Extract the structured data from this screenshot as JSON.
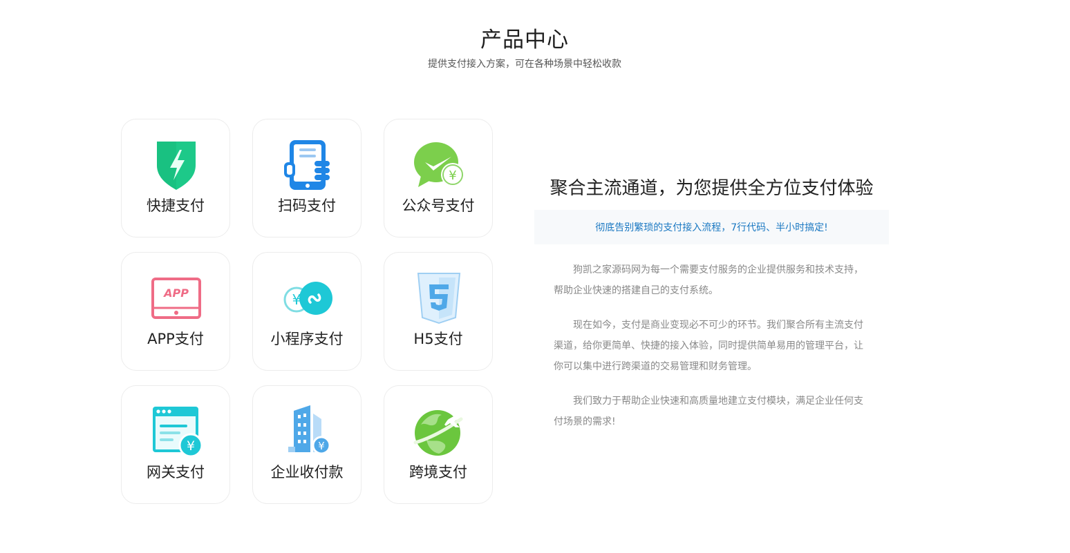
{
  "header": {
    "title": "产品中心",
    "subtitle": "提供支付接入方案，可在各种场景中轻松收款"
  },
  "products": [
    {
      "label": "快捷支付",
      "icon": "shield-lightning-icon"
    },
    {
      "label": "扫码支付",
      "icon": "phone-scan-icon"
    },
    {
      "label": "公众号支付",
      "icon": "wechat-pay-icon"
    },
    {
      "label": "APP支付",
      "icon": "app-screen-icon"
    },
    {
      "label": "小程序支付",
      "icon": "mini-program-icon"
    },
    {
      "label": "H5支付",
      "icon": "html5-icon"
    },
    {
      "label": "网关支付",
      "icon": "browser-yuan-icon"
    },
    {
      "label": "企业收付款",
      "icon": "building-yuan-icon"
    },
    {
      "label": "跨境支付",
      "icon": "globe-plane-icon"
    }
  ],
  "intro": {
    "headline": "聚合主流通道，为您提供全方位支付体验",
    "slogan": "彻底告别繁琐的支付接入流程，7行代码、半小时搞定!",
    "paragraphs": [
      "狗凯之家源码网为每一个需要支付服务的企业提供服务和技术支持，帮助企业快速的搭建自己的支付系统。",
      "现在如今，支付是商业变现必不可少的环节。我们聚合所有主流支付渠道，给你更简单、快捷的接入体验，同时提供简单易用的管理平台，让你可以集中进行跨渠道的交易管理和财务管理。",
      "我们致力于帮助企业快速和高质量地建立支付模块，满足企业任何支付场景的需求!"
    ]
  },
  "colors": {
    "accent_blue": "#1a78c2",
    "green": "#1dc989",
    "scan_blue": "#1f86e6",
    "wechat_green": "#7ccf4c",
    "app_pink": "#ef6c86",
    "cyan": "#1ec8d6",
    "html5_blue": "#4fa8e8"
  }
}
